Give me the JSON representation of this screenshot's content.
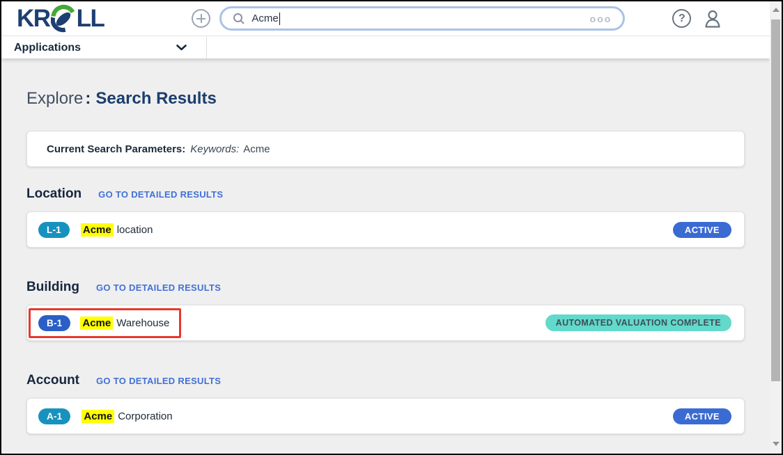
{
  "brand": {
    "logo_left": "KR",
    "logo_right": "LL"
  },
  "header": {
    "search": {
      "value": "Acme",
      "more_label": "ooo"
    },
    "applications_label": "Applications",
    "help_glyph": "?"
  },
  "icons": {
    "add": "plus-circle",
    "search": "magnifier",
    "more": "triple-dots",
    "help": "question-circle",
    "account": "person-outline",
    "applications": "chevron-down",
    "scroll_up": "triangle-up",
    "scroll_down": "triangle-down"
  },
  "page_title": {
    "prefix": "Explore",
    "separator": ":",
    "main": "Search Results"
  },
  "search_params": {
    "label": "Current Search Parameters:",
    "keywords_label": "Keywords:",
    "keywords_value": "Acme"
  },
  "sections": [
    {
      "title": "Location",
      "link_label": "GO TO DETAILED RESULTS",
      "item": {
        "badge": "L-1",
        "name_highlight": "Acme",
        "name_rest": "location",
        "status": "ACTIVE"
      }
    },
    {
      "title": "Building",
      "link_label": "GO TO DETAILED RESULTS",
      "item": {
        "badge": "B-1",
        "name_highlight": "Acme",
        "name_rest": "Warehouse",
        "status": "AUTOMATED VALUATION COMPLETE"
      }
    },
    {
      "title": "Account",
      "link_label": "GO TO DETAILED RESULTS",
      "item": {
        "badge": "A-1",
        "name_highlight": "Acme",
        "name_rest": "Corporation",
        "status": "ACTIVE"
      }
    }
  ],
  "colors": {
    "logo_navy": "#1e3f72",
    "logo_green": "#46a835",
    "link_blue": "#4170d8",
    "badge_teal": "#1792be",
    "badge_blue": "#2b5fc7",
    "status_active_bg": "#3a6bd2",
    "status_complete_bg": "#62d9ca",
    "status_complete_text": "#3d4f58",
    "highlight_yellow": "#ffff00",
    "annotation_red": "#e8382e",
    "content_bg": "#efefef",
    "search_border": "#a9c3e6"
  }
}
